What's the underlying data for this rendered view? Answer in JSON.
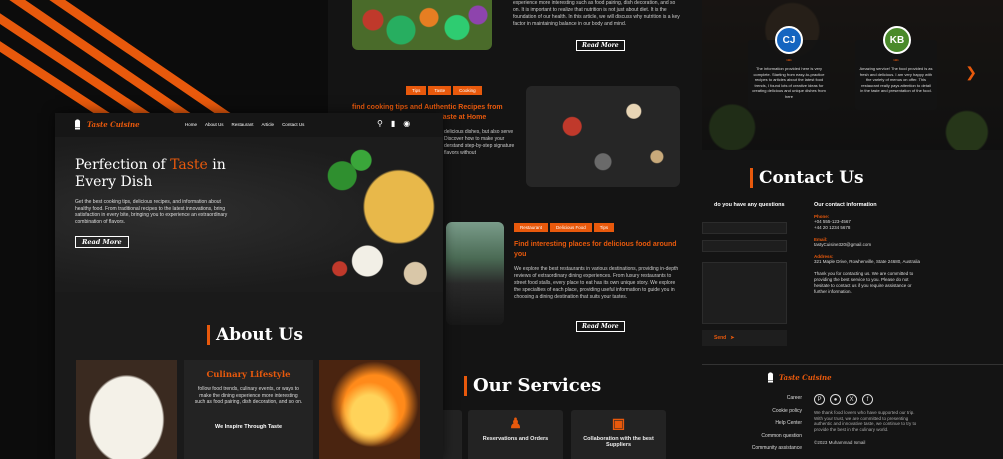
{
  "colors": {
    "accent": "#e8590c",
    "background": "#141414",
    "panel": "#1a1a1a",
    "card": "#232323"
  },
  "blog": {
    "intro_text": "experience more interesting such as food pairing, dish decoration, and so on. It is important to realize that nutrition is not just about diet. It is the foundation of our health. In this article, we will discuss why nutrition is a key factor in maintaining balance in our body and mind.",
    "read_more": "Read More",
    "post2": {
      "tags": [
        "Tips",
        "Taste",
        "Cooking"
      ],
      "title_line1": "find cooking tips and Authentic Recipes from",
      "title_line2": "ur Taste at Home",
      "text": "delicious dishes, but also serve Discover how to make your derstand step-by-step signature flavors without"
    },
    "post3": {
      "tags": [
        "Restaurant",
        "Delicious Food",
        "Tips"
      ],
      "title": "Find interesting places for delicious food around you",
      "text": "We explore the best restaurants in various destinations, providing in-depth reviews of extraordinary dining experiences. From luxury restaurants to street food stalls, every place to eat has its own unique story. We explore the specialties of each place, providing useful information to guide you in choosing a dining destination that suits your tastes."
    },
    "services": {
      "title": "Our Services",
      "items": [
        {
          "label": "Reservations and Orders",
          "icon": "person-reservation-icon"
        },
        {
          "label": "Collaboration with the best Suppliers",
          "icon": "delivery-truck-icon"
        }
      ]
    }
  },
  "testimonials": [
    {
      "initials": "CJ",
      "color": "#1565c0",
      "quote_mark": "““",
      "text": "The information provided here is very complete. Starting from easy-to-practice recipes to articles about the latest food trends, I found lots of creative ideas for creating delicious and unique dishes from here"
    },
    {
      "initials": "KB",
      "color": "#4a8a2a",
      "quote_mark": "““",
      "text": "Amazing service! The food provided is as fresh and delicious. I am very happy with the variety of menus on offer. This restaurant really pays attention to detail in the taste and presentation of the food."
    }
  ],
  "contact": {
    "title": "Contact Us",
    "form_question": "do you have any questions",
    "send_label": "Send",
    "info_heading": "Our contact information",
    "phone_label": "Phone:",
    "phone_1": "+04 555-123-4567",
    "phone_2": "+44 20 1234 5678",
    "email_label": "Email:",
    "email": "tastyCuisine320@gmail.com",
    "address_label": "Address:",
    "address": "321 Maple Drive, Rowhenville, State 24680, Australia",
    "note": "Thank you for contacting us. We are committed to providing the best service to you. Please do not hesitate to contact us if you require assistance or further information."
  },
  "footer": {
    "brand": "Taste Cuisine",
    "links": [
      "Career",
      "Cookie policy",
      "Help Center",
      "Common question",
      "Community assistance"
    ],
    "socials": [
      "pinterest-icon",
      "instagram-icon",
      "x-icon",
      "facebook-icon"
    ],
    "description": "We thank food lovers who have supported our trip. With your trust, we are committed to presenting authentic and innovative taste, we continue to try to provide the best in the culinary world.",
    "copyright": "©2023 Muhammad Ismail"
  },
  "front": {
    "brand": "Taste Cuisine",
    "nav": [
      "Home",
      "About Us",
      "Restaurant",
      "Article",
      "Contact Us"
    ],
    "nav_icons": [
      "search-icon",
      "bookmark-icon",
      "globe-icon"
    ],
    "hero": {
      "title_part1": "Perfection of ",
      "title_accent": "Taste",
      "title_part2": " in",
      "title_line2": "Every Dish",
      "text": "Get the best cooking tips, delicious recipes, and information about healthy food. From traditional recipes to the latest innovations, bring satisfaction in every bite, bringing you to experience an extraordinary combination of flavors.",
      "button": "Read More"
    },
    "about": {
      "title": "About Us",
      "card_title": "Culinary Lifestyle",
      "card_text": "follow food trends, culinary events, or ways to make the dining experience more interesting such as food pairing, dish decoration, and so on.",
      "card_sub": "We Inspire Through Taste"
    }
  }
}
